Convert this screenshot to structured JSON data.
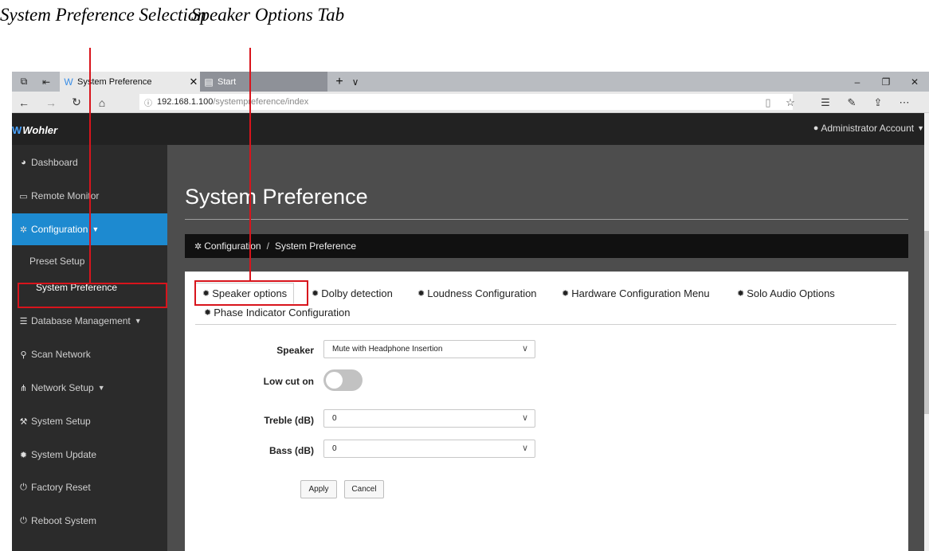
{
  "annotations": {
    "system_preference_selection": "System Preference Selection",
    "speaker_options_tab": "Speaker Options Tab"
  },
  "browser": {
    "tabs": [
      {
        "title": "System Preference",
        "icon": "wohler-favicon",
        "active": true
      },
      {
        "title": "Start",
        "icon": "start-page-icon",
        "active": false
      }
    ],
    "new_tab_label": "+",
    "tab_list_label": "∨",
    "url_host": "192.168.1.100",
    "url_path": "/systempreference/index",
    "window_controls": [
      "–",
      "❐",
      "✕"
    ],
    "toolbar_right": [
      "reading-view-icon",
      "favorites-star-icon",
      "favorites-list-icon",
      "pen-icon",
      "share-icon",
      "more-icon"
    ]
  },
  "app": {
    "logo_text": "Wohler",
    "account_label": "Administrator Account",
    "sidebar": {
      "items": [
        {
          "label": "Dashboard",
          "icon": "dashboard-icon"
        },
        {
          "label": "Remote Monitor",
          "icon": "monitor-icon"
        },
        {
          "label": "Configuration",
          "icon": "cogs-icon",
          "active": true,
          "expanded": true
        },
        {
          "label": "Database Management",
          "icon": "database-icon"
        },
        {
          "label": "Scan Network",
          "icon": "search-icon"
        },
        {
          "label": "Network Setup",
          "icon": "network-icon"
        },
        {
          "label": "System Setup",
          "icon": "wrench-icon"
        },
        {
          "label": "System Update",
          "icon": "gear-icon"
        },
        {
          "label": "Factory Reset",
          "icon": "power-icon"
        },
        {
          "label": "Reboot System",
          "icon": "power-icon"
        }
      ],
      "submenu": [
        {
          "label": "Preset Setup"
        },
        {
          "label": "System Preference",
          "selected": true
        }
      ]
    },
    "page": {
      "title": "System Preference",
      "breadcrumb": [
        "Configuration",
        "System Preference"
      ],
      "breadcrumb_separator": "/"
    },
    "tabs": [
      {
        "label": "Speaker options",
        "active": true
      },
      {
        "label": "Dolby detection"
      },
      {
        "label": "Loudness Configuration"
      },
      {
        "label": "Hardware Configuration Menu"
      },
      {
        "label": "Solo Audio Options"
      },
      {
        "label": "Phase Indicator Configuration"
      }
    ],
    "form": {
      "speaker": {
        "label": "Speaker",
        "value": "Mute with Headphone Insertion"
      },
      "low_cut": {
        "label": "Low cut on",
        "on": false
      },
      "treble": {
        "label": "Treble (dB)",
        "value": "0"
      },
      "bass": {
        "label": "Bass (dB)",
        "value": "0"
      },
      "apply_label": "Apply",
      "cancel_label": "Cancel"
    }
  },
  "colors": {
    "accent": "#1d8ad0",
    "annotation_red": "#d8141c",
    "sidebar_bg": "#2b2b2b",
    "content_bg": "#4d4d4d",
    "topbar_bg": "#222222"
  }
}
